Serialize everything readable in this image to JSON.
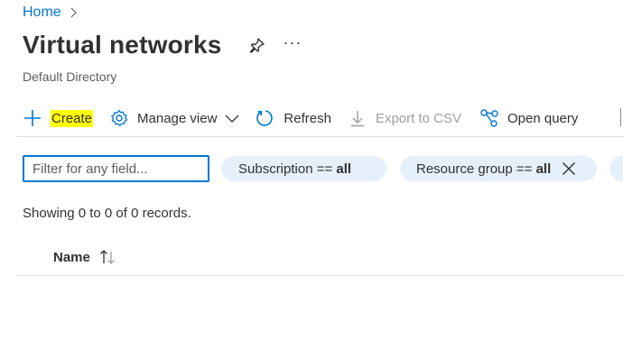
{
  "breadcrumb": {
    "home_label": "Home"
  },
  "header": {
    "title": "Virtual networks",
    "more_label": "···",
    "subtitle": "Default Directory"
  },
  "toolbar": {
    "create_label": "Create",
    "manage_view_label": "Manage view",
    "refresh_label": "Refresh",
    "export_label": "Export to CSV",
    "open_query_label": "Open query",
    "create_highlight_color": "#ffff00",
    "accent_color": "#0078d4"
  },
  "filters": {
    "search_placeholder": "Filter for any field...",
    "search_value": "",
    "subscription_prefix": "Subscription == ",
    "subscription_value": "all",
    "resource_group_prefix": "Resource group == ",
    "resource_group_value": "all"
  },
  "records": {
    "summary": "Showing 0 to 0 of 0 records."
  },
  "table": {
    "columns": [
      "Name"
    ],
    "rows": []
  },
  "icons": {
    "breadcrumb_sep": "chevron-right-icon",
    "pin": "pin-icon",
    "create": "plus-icon",
    "manage_view": "gear-icon",
    "manage_view_caret": "chevron-down-icon",
    "refresh": "refresh-icon",
    "export": "download-icon",
    "open_query": "query-graph-icon",
    "clear_filter": "close-icon",
    "sort": "sort-icon"
  }
}
